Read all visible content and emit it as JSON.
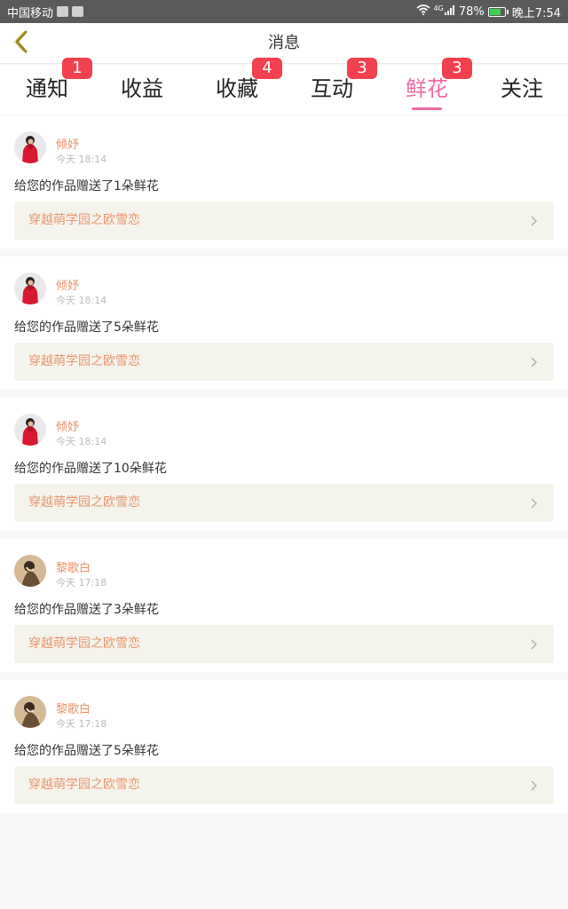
{
  "status_bar": {
    "carrier": "中国移动",
    "network": "4G",
    "battery": "78%",
    "battery_level": 0.78,
    "time": "晚上7:54"
  },
  "header": {
    "title": "消息"
  },
  "tabs": [
    {
      "label": "通知",
      "badge": "1"
    },
    {
      "label": "收益",
      "badge": ""
    },
    {
      "label": "收藏",
      "badge": "4"
    },
    {
      "label": "互动",
      "badge": "3"
    },
    {
      "label": "鲜花",
      "badge": "3",
      "active": true
    },
    {
      "label": "关注",
      "badge": ""
    }
  ],
  "colors": {
    "accent": "#f06aa0",
    "badge": "#f2404e",
    "name": "#e8936a",
    "link_bg": "#f5f4ec"
  },
  "messages": [
    {
      "avatar": "red-jacket",
      "name": "倾妤",
      "time": "今天 18:14",
      "text": "给您的作品赠送了1朵鲜花",
      "work": "穿越萌学园之欧雪恋"
    },
    {
      "avatar": "red-jacket",
      "name": "倾妤",
      "time": "今天 18:14",
      "text": "给您的作品赠送了5朵鲜花",
      "work": "穿越萌学园之欧雪恋"
    },
    {
      "avatar": "red-jacket",
      "name": "倾妤",
      "time": "今天 18:14",
      "text": "给您的作品赠送了10朵鲜花",
      "work": "穿越萌学园之欧雪恋"
    },
    {
      "avatar": "sepia-figure",
      "name": "黎歌白",
      "time": "今天 17:18",
      "text": "给您的作品赠送了3朵鲜花",
      "work": "穿越萌学园之欧雪恋"
    },
    {
      "avatar": "sepia-figure",
      "name": "黎歌白",
      "time": "今天 17:18",
      "text": "给您的作品赠送了5朵鲜花",
      "work": "穿越萌学园之欧雪恋"
    }
  ]
}
